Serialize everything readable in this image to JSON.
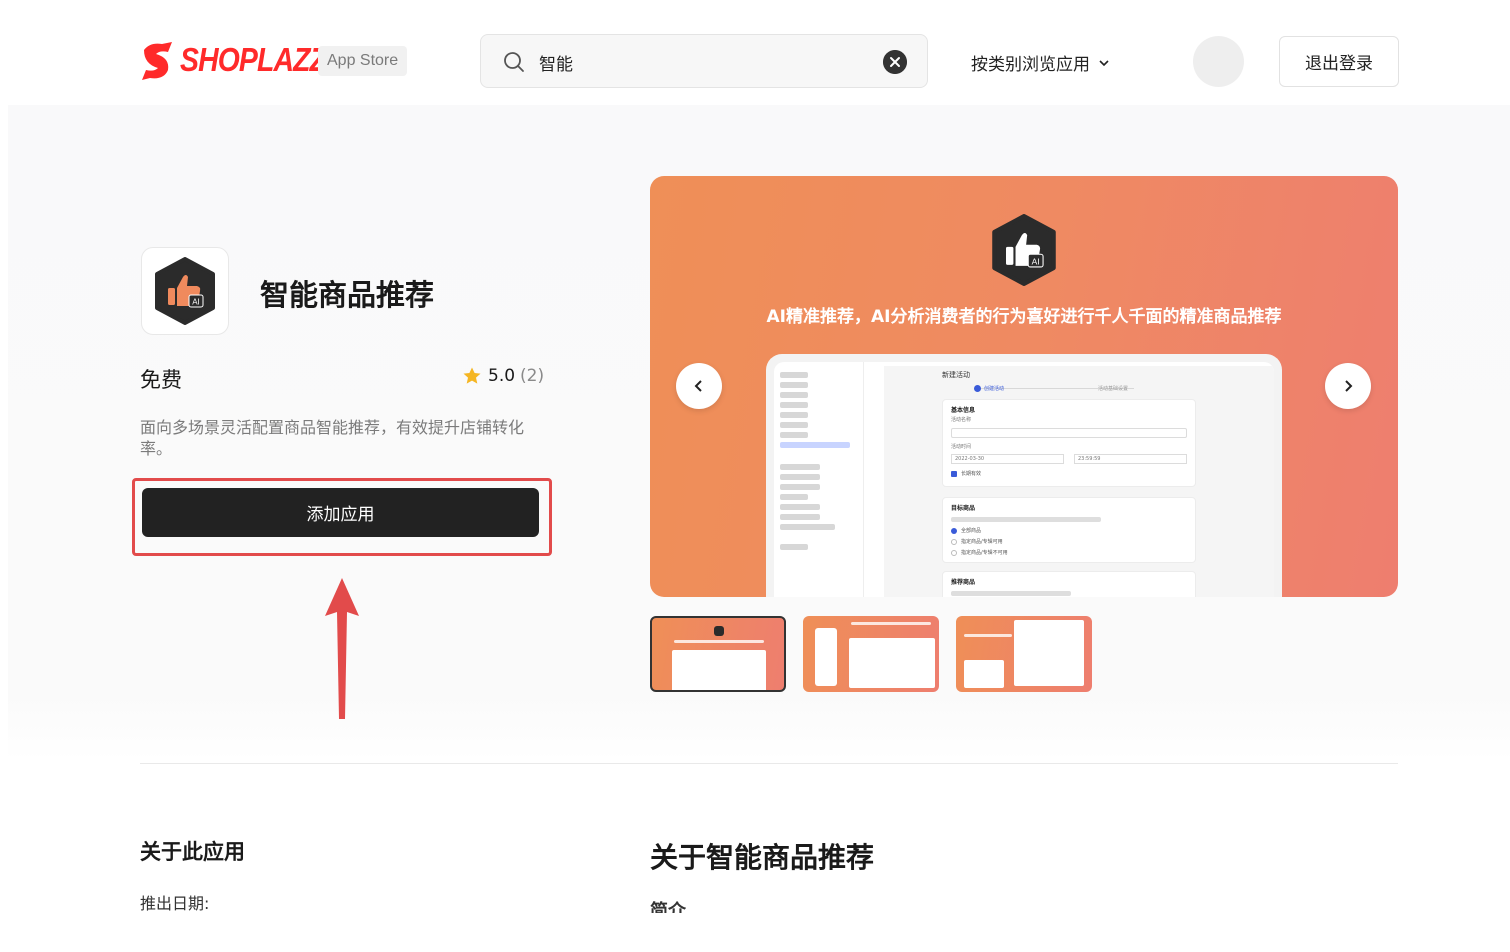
{
  "header": {
    "brand": "SHOPLAZZA",
    "badge": "App Store",
    "search": {
      "value": "智能"
    },
    "browse_label": "按类别浏览应用",
    "logout_label": "退出登录"
  },
  "app": {
    "name": "智能商品推荐",
    "price": "免费",
    "rating": "5.0",
    "rating_count": "(2)",
    "description": "面向多场景灵活配置商品智能推荐，有效提升店铺转化率。",
    "add_button": "添加应用"
  },
  "banner": {
    "caption": "AI精准推荐，AI分析消费者的行为喜好进行千人千面的精准商品推荐",
    "mock": {
      "page_title": "新建活动",
      "step_1": "创建活动",
      "step_2": "活动基础设置",
      "section_basic": "基本信息",
      "field_name": "活动名称",
      "field_time": "活动时间",
      "date_value": "2022-03-30",
      "time_value": "23:59:59",
      "checkbox_label": "长期有效",
      "section_target": "目标商品",
      "radio_1": "全部商品",
      "radio_2": "指定商品/专辑可用",
      "radio_3": "指定商品/专辑不可用",
      "section_recommend": "推荐商品",
      "side_items": [
        "主页",
        "订单",
        "商品",
        "客户",
        "营销",
        "分析",
        "渠道",
        "应用"
      ],
      "side_channels": [
        "在线商店",
        "Google",
        "TikTok",
        "Facebook",
        "Snapchat",
        "Microsoft",
        "设置"
      ]
    }
  },
  "about": {
    "heading": "关于此应用",
    "launch_label": "推出日期:",
    "title": "关于智能商品推荐",
    "intro_label": "简介"
  },
  "colors": {
    "brand_red": "#ff2a2a",
    "highlight_red": "#e24b4b",
    "banner_orange": "#ef8f57",
    "button_dark": "#222222",
    "star": "#f5b623"
  }
}
